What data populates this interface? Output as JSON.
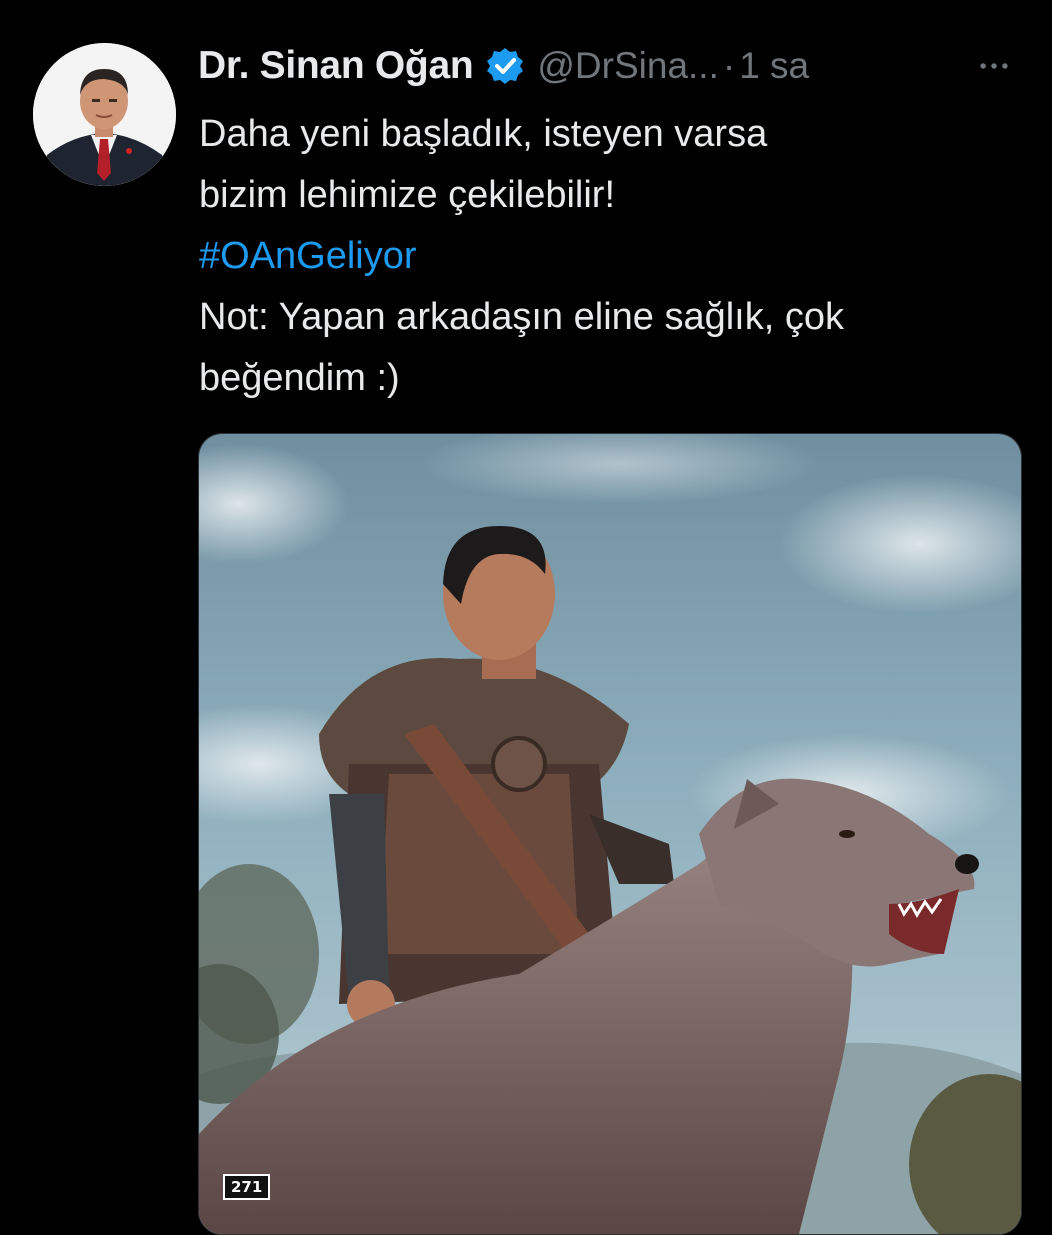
{
  "tweet": {
    "author": {
      "display_name": "Dr. Sinan Oğan",
      "verified_icon": "verified-badge-icon",
      "handle": "@DrSina...",
      "separator": "·",
      "time": "1 sa"
    },
    "more_icon": "more-horizontal-icon",
    "text_lines": [
      "Daha yeni başladık, isteyen varsa",
      "bizim lehimize çekilebilir!"
    ],
    "hashtag": "#OAnGeliyor",
    "note_lines": [
      "Not: Yapan arkadaşın eline sağlık, çok",
      "beğendim :)"
    ],
    "media": {
      "badge_text": "271"
    }
  },
  "colors": {
    "background": "#000000",
    "text": "#e7e9ea",
    "secondary": "#71767b",
    "accent": "#1d9bf0"
  }
}
